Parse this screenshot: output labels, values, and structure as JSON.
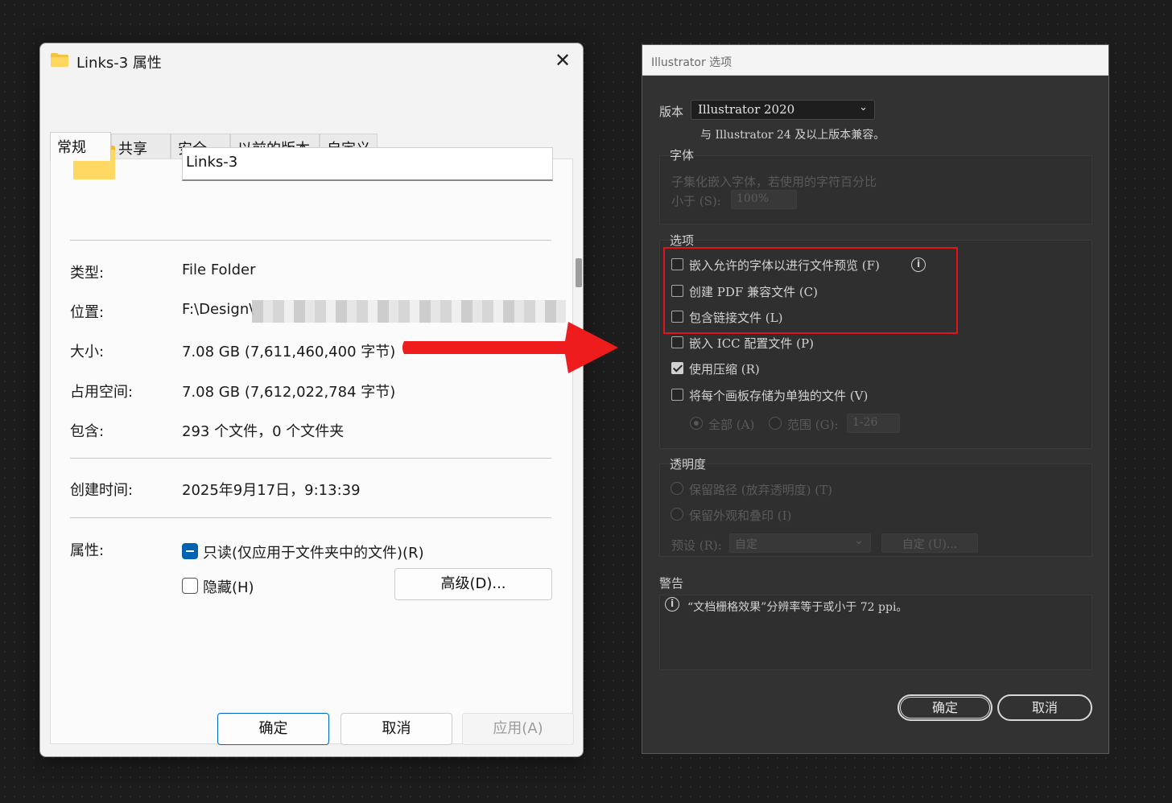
{
  "win": {
    "title": "Links-3 属性",
    "close_glyph": "✕",
    "tabs": [
      "常规",
      "共享",
      "安全",
      "以前的版本",
      "自定义"
    ],
    "name_value": "Links-3",
    "labels": {
      "type": "类型:",
      "location": "位置:",
      "size": "大小:",
      "size_on_disk": "占用空间:",
      "contains": "包含:",
      "created": "创建时间:",
      "attributes": "属性:"
    },
    "values": {
      "type": "File Folder",
      "location": "F:\\Design\\",
      "size": "7.08 GB (7,611,460,400 字节)",
      "size_on_disk": "7.08 GB (7,612,022,784 字节)",
      "contains": "293 个文件，0 个文件夹",
      "created": "2025年9月17日，9:13:39"
    },
    "attributes": {
      "readonly_label": "只读(仅应用于文件夹中的文件)(R)",
      "hidden_label": "隐藏(H)",
      "advanced_button": "高级(D)..."
    },
    "buttons": {
      "ok": "确定",
      "cancel": "取消",
      "apply": "应用(A)"
    },
    "colors": {
      "accent": "#0063b1",
      "folder": "#ffd54f"
    }
  },
  "arrow": {
    "color": "#ee1c1c"
  },
  "ai": {
    "title": "Illustrator 选项",
    "version_label": "版本",
    "version_value": "Illustrator 2020",
    "compat_note": "与 Illustrator 24 及以上版本兼容。",
    "font_group": {
      "title": "字体",
      "subset_text": "子集化嵌入字体，若使用的字符百分比",
      "less_than_label": "小于 (S):",
      "percent_value": "100%"
    },
    "options_group": {
      "title": "选项",
      "items": [
        {
          "label": "嵌入允许的字体以进行文件预览 (F)",
          "checked": false,
          "highlighted": true
        },
        {
          "label": "创建 PDF 兼容文件 (C)",
          "checked": false,
          "highlighted": true
        },
        {
          "label": "包含链接文件 (L)",
          "checked": false,
          "highlighted": true
        },
        {
          "label": "嵌入 ICC 配置文件 (P)",
          "checked": false,
          "highlighted": false
        },
        {
          "label": "使用压缩 (R)",
          "checked": true,
          "highlighted": false
        },
        {
          "label": "将每个画板存储为单独的文件 (V)",
          "checked": false,
          "highlighted": false
        }
      ],
      "all_label": "全部 (A)",
      "range_label": "范围 (G):",
      "range_value": "1-26"
    },
    "transparency_group": {
      "title": "透明度",
      "preserve_paths": "保留路径 (放弃透明度) (T)",
      "preserve_appearance": "保留外观和叠印 (I)",
      "preset_label": "预设 (R):",
      "preset_value": "自定",
      "custom_button": "自定 (U)..."
    },
    "warnings": {
      "title": "警告",
      "message": "“文档栅格效果”分辨率等于或小于 72 ppi。"
    },
    "buttons": {
      "ok": "确定",
      "cancel": "取消"
    },
    "colors": {
      "highlight": "#e0141a",
      "background": "#323232"
    }
  }
}
